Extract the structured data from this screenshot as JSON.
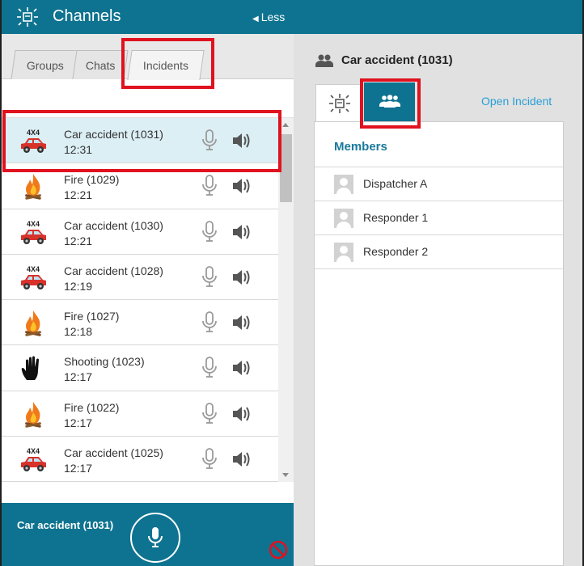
{
  "header": {
    "title": "Channels",
    "less_label": "Less",
    "accent": "#0e7390"
  },
  "tabs": [
    {
      "label": "Groups"
    },
    {
      "label": "Chats"
    },
    {
      "label": "Incidents",
      "active": true
    }
  ],
  "incidents": [
    {
      "name": "Car accident (1031)",
      "time": "12:31",
      "icon": "car-icon",
      "selected": true
    },
    {
      "name": "Fire (1029)",
      "time": "12:21",
      "icon": "fire-icon"
    },
    {
      "name": "Car accident (1030)",
      "time": "12:21",
      "icon": "car-icon"
    },
    {
      "name": "Car accident (1028)",
      "time": "12:19",
      "icon": "car-icon"
    },
    {
      "name": "Fire (1027)",
      "time": "12:18",
      "icon": "fire-icon"
    },
    {
      "name": "Shooting (1023)",
      "time": "12:17",
      "icon": "hand-icon"
    },
    {
      "name": "Fire (1022)",
      "time": "12:17",
      "icon": "fire-icon"
    },
    {
      "name": "Car accident (1025)",
      "time": "12:17",
      "icon": "car-icon"
    }
  ],
  "car_badge": "4X4",
  "footer": {
    "channel_name": "Car accident (1031)"
  },
  "detail": {
    "title": "Car accident (1031)",
    "open_incident_label": "Open Incident",
    "members_heading": "Members",
    "members": [
      {
        "name": "Dispatcher A"
      },
      {
        "name": "Responder 1"
      },
      {
        "name": "Responder 2"
      }
    ]
  },
  "colors": {
    "highlight": "#e0121f",
    "selected_row": "#dbeff4",
    "link": "#2a9fd6"
  }
}
